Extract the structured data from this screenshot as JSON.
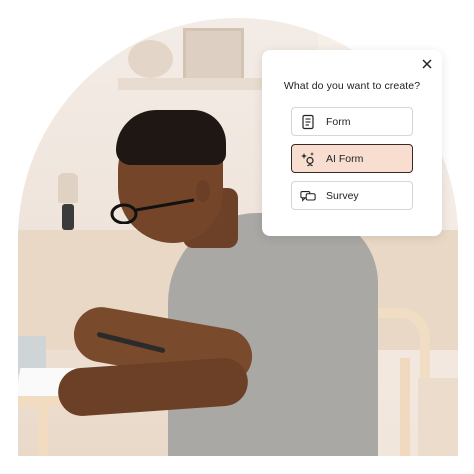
{
  "modal": {
    "close_icon": "close-icon",
    "title": "What do you want to create?",
    "options": [
      {
        "label": "Form",
        "icon": "form-document-icon",
        "selected": false
      },
      {
        "label": "AI Form",
        "icon": "ai-sparkle-icon",
        "selected": true
      },
      {
        "label": "Survey",
        "icon": "survey-chat-icon",
        "selected": false
      }
    ],
    "selected_bg": "#f7ded0",
    "selected_border": "#3a2a25"
  }
}
